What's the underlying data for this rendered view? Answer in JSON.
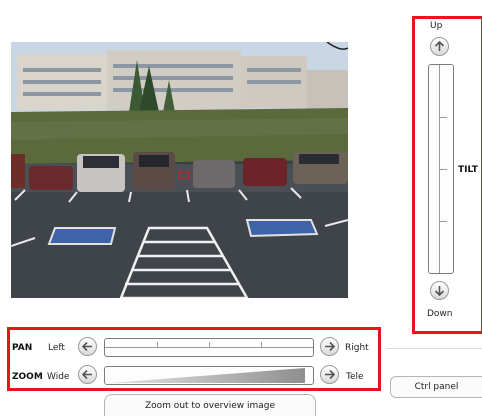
{
  "camera": {
    "image_alt": "Live camera view of a parking lot in front of a building"
  },
  "tilt": {
    "title": "TILT",
    "up_label": "Up",
    "down_label": "Down",
    "up_icon": "arrow-up-icon",
    "down_icon": "arrow-down-icon"
  },
  "pan": {
    "title": "PAN",
    "left_label": "Left",
    "right_label": "Right",
    "left_icon": "arrow-left-icon",
    "right_icon": "arrow-right-icon"
  },
  "zoom": {
    "title": "ZOOM",
    "wide_label": "Wide",
    "tele_label": "Tele",
    "wide_icon": "arrow-left-icon",
    "tele_icon": "arrow-right-icon"
  },
  "buttons": {
    "ctrl_panel": "Ctrl panel",
    "zoom_out": "Zoom out to overview image"
  },
  "colors": {
    "highlight": "#e8151d"
  }
}
